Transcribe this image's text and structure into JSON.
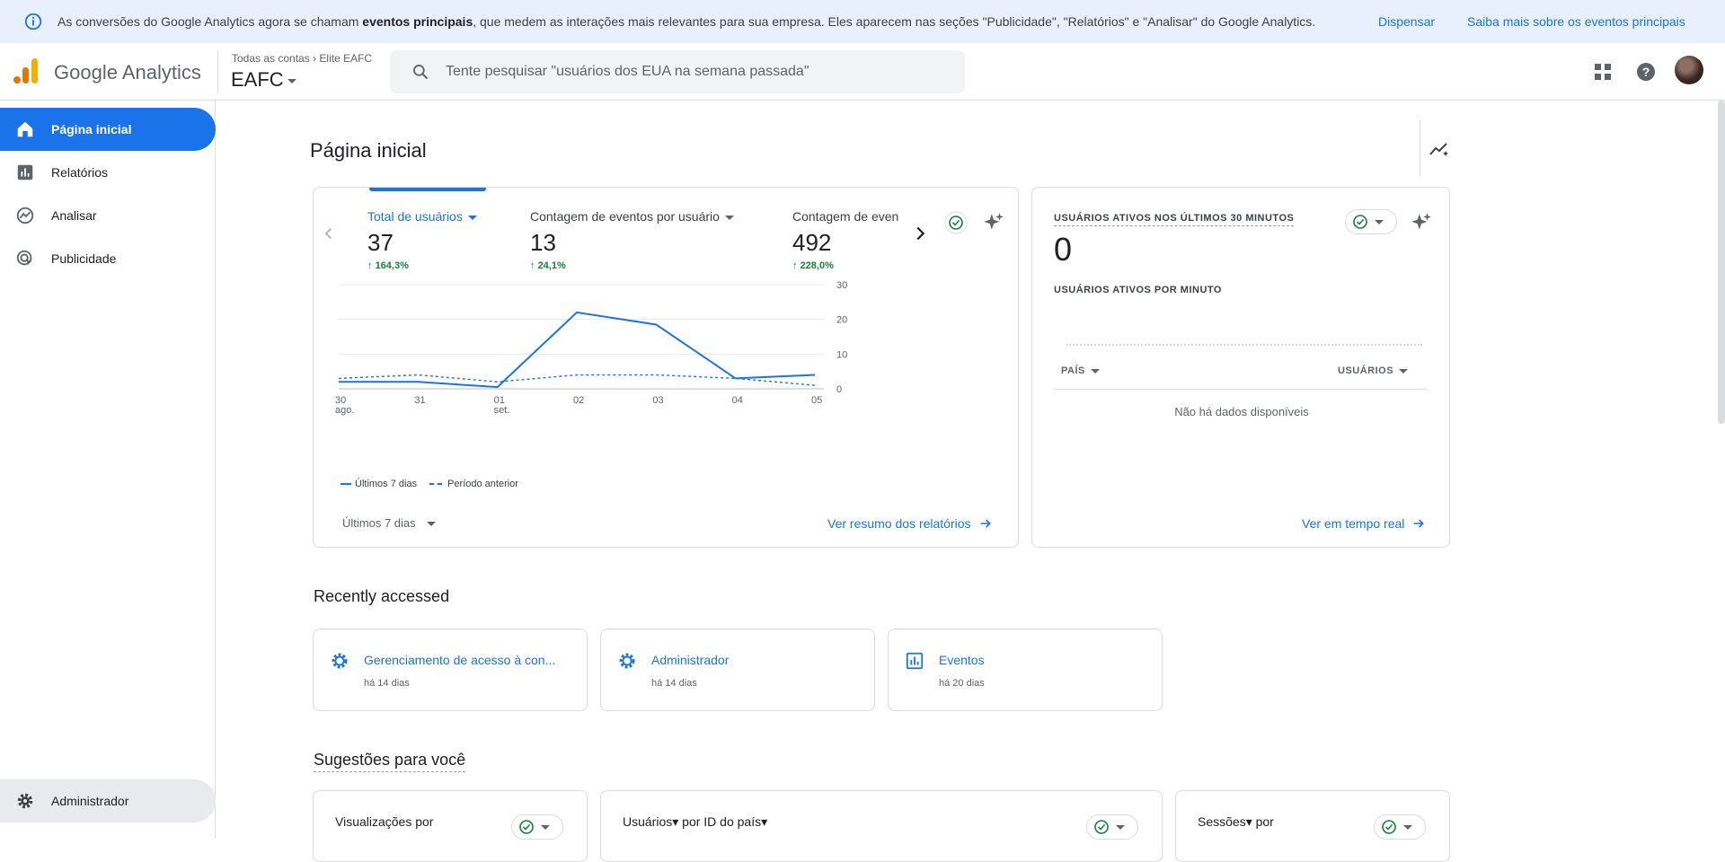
{
  "banner": {
    "message_pre": "As conversões do Google Analytics agora se chamam ",
    "message_bold": "eventos principais",
    "message_post": ", que medem as interações mais relevantes para sua empresa. Eles aparecem nas seções \"Publicidade\", \"Relatórios\" e \"Analisar\" do Google Analytics.",
    "dismiss": "Dispensar",
    "learn_more": "Saiba mais sobre os eventos principais"
  },
  "header": {
    "product": "Google Analytics",
    "crumb_all": "Todas as contas",
    "crumb_account": "Elite EAFC",
    "property": "EAFC",
    "search_placeholder": "Tente pesquisar \"usuários dos EUA na semana passada\""
  },
  "sidebar": {
    "items": [
      {
        "label": "Página inicial",
        "icon": "home-icon"
      },
      {
        "label": "Relatórios",
        "icon": "reports-icon"
      },
      {
        "label": "Analisar",
        "icon": "explore-icon"
      },
      {
        "label": "Publicidade",
        "icon": "advertising-icon"
      }
    ],
    "admin": "Administrador"
  },
  "main": {
    "title": "Página inicial",
    "overview": {
      "metrics": [
        {
          "label": "Total de usuários",
          "value": "37",
          "change": "164,3%"
        },
        {
          "label": "Contagem de eventos por usuário",
          "value": "13",
          "change": "24,1%"
        },
        {
          "label": "Contagem de even",
          "value": "492",
          "change": "228,0%"
        }
      ],
      "legend_current": "Últimos 7 dias",
      "legend_previous": "Período anterior",
      "date_range": "Últimos 7 dias",
      "view_link": "Ver resumo dos relatórios"
    },
    "realtime": {
      "title": "USUÁRIOS ATIVOS NOS ÚLTIMOS 30 MINUTOS",
      "value": "0",
      "per_minute": "USUÁRIOS ATIVOS POR MINUTO",
      "col_country": "PAÍS",
      "col_users": "USUÁRIOS",
      "no_data": "Não há dados disponíveis",
      "view_link": "Ver em tempo real"
    },
    "recent": {
      "title": "Recently accessed",
      "items": [
        {
          "title": "Gerenciamento de acesso à con...",
          "sub": "há 14 dias",
          "icon": "gear-icon"
        },
        {
          "title": "Administrador",
          "sub": "há 14 dias",
          "icon": "gear-icon"
        },
        {
          "title": "Eventos",
          "sub": "há 20 dias",
          "icon": "report-chart-icon"
        }
      ]
    },
    "suggestions": {
      "title": "Sugestões para você",
      "cards": [
        {
          "title": "Visualizações por"
        },
        {
          "title": "Usuários▾ por ID do país▾"
        },
        {
          "title": "Sessões▾ por"
        }
      ]
    }
  },
  "chart_data": {
    "type": "line",
    "x": [
      "30 ago.",
      "31",
      "01 set.",
      "02",
      "03",
      "04",
      "05"
    ],
    "series": [
      {
        "name": "Últimos 7 dias",
        "values": [
          2,
          2,
          0.5,
          22,
          18.5,
          3,
          4
        ]
      },
      {
        "name": "Período anterior",
        "values": [
          3,
          4,
          2,
          4,
          4,
          3,
          1
        ]
      }
    ],
    "y_ticks": [
      0,
      10,
      20,
      30
    ],
    "ylim": [
      0,
      30
    ],
    "colors": {
      "current": "#1a73e8",
      "previous": "#1a73e8"
    },
    "grid": true,
    "legend_position": "bottom-left"
  }
}
